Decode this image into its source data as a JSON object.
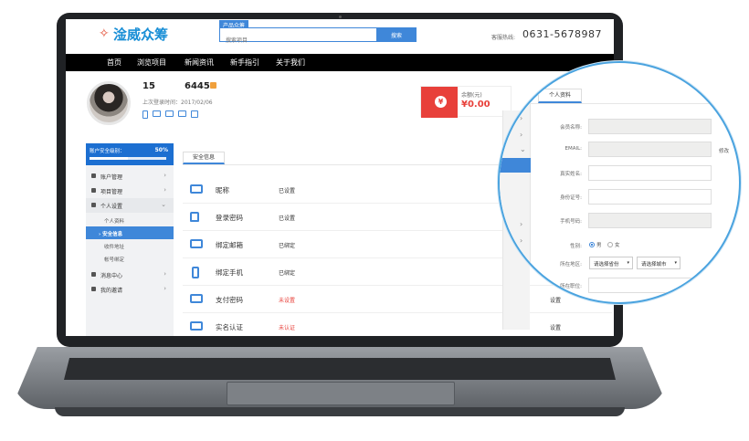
{
  "header": {
    "logo_mark": "✧",
    "logo_text": "淦威众筹",
    "search_tag": "产品众筹",
    "search_placeholder": "搜索项目",
    "search_button": "搜索",
    "hotline_label": "客服热线:",
    "hotline_number": "0631-5678987"
  },
  "nav": {
    "items": [
      "首页",
      "浏览项目",
      "新闻资讯",
      "新手指引",
      "关于我们"
    ]
  },
  "profile": {
    "user_id": "15",
    "points": "6445",
    "last_login": "上次登录时间：2017/02/06",
    "balance_badge": "¥",
    "balance_label": "余额(元)",
    "balance_value": "¥0.00"
  },
  "sidebar": {
    "security_label": "账户安全级别：",
    "security_percent": "50%",
    "security_level": 0.5,
    "items": [
      {
        "label": "账户管理",
        "chevron": "›"
      },
      {
        "label": "项目管理",
        "chevron": "›"
      },
      {
        "label": "个人设置",
        "chevron": "⌄"
      },
      {
        "label": "消息中心",
        "chevron": "›"
      },
      {
        "label": "我的邀请",
        "chevron": "›"
      }
    ],
    "sub_items": [
      {
        "label": "个人资料"
      },
      {
        "label": "› 安全信息"
      },
      {
        "label": "收件地址"
      },
      {
        "label": "帐号绑定"
      }
    ]
  },
  "main": {
    "tab_label": "安全信息",
    "rows": [
      {
        "name": "昵称",
        "status": "已设置",
        "action": ""
      },
      {
        "name": "登录密码",
        "status": "已设置",
        "action": ""
      },
      {
        "name": "绑定邮箱",
        "status": "已绑定",
        "action": ""
      },
      {
        "name": "绑定手机",
        "status": "已绑定",
        "action": ""
      },
      {
        "name": "支付密码",
        "status": "未设置",
        "action": "设置"
      },
      {
        "name": "实名认证",
        "status": "未认证",
        "action": "设置"
      }
    ]
  },
  "magnifier": {
    "tab_label": "个人资料",
    "fields": {
      "member_name": "会员名称:",
      "email": "EMAIL:",
      "real_name": "真实姓名:",
      "id_number": "身份证号:",
      "phone": "手机号码:",
      "gender": "性别:",
      "region": "所在地区:",
      "position": "所在职位:"
    },
    "edit_link": "修改",
    "gender_options": {
      "male": "男",
      "female": "女"
    },
    "province_select": "请选择省份",
    "city_select": "请选择城市",
    "chevron": "›",
    "chevron_down": "⌄",
    "caret": "▾"
  },
  "colors": {
    "accent": "#3f87d9",
    "danger": "#e8403a",
    "nav_bg": "#000000"
  }
}
